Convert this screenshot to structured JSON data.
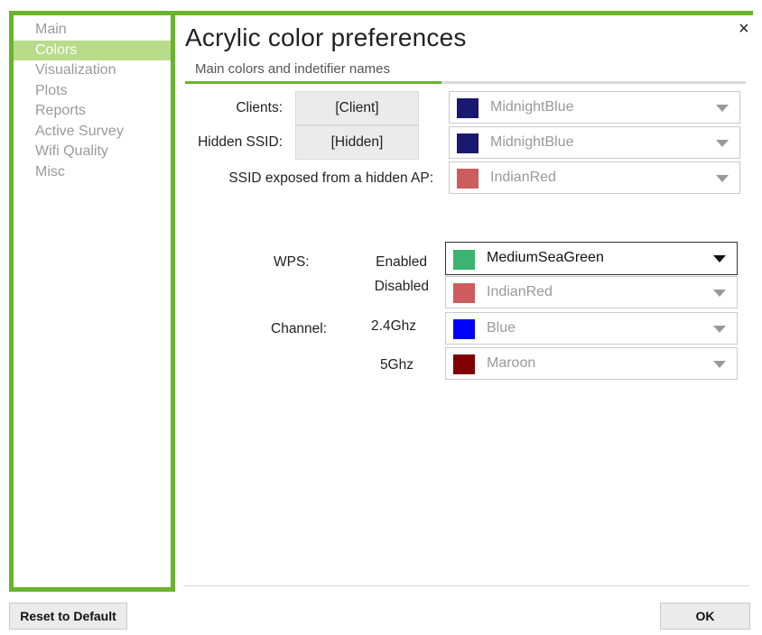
{
  "window": {
    "title": "Acrylic color preferences",
    "subtitle": "Main colors and indetifier names",
    "close_glyph": "×"
  },
  "sidebar": {
    "items": [
      {
        "label": "Main",
        "active": false
      },
      {
        "label": "Colors",
        "active": true
      },
      {
        "label": "Visualization",
        "active": false
      },
      {
        "label": "Plots",
        "active": false
      },
      {
        "label": "Reports",
        "active": false
      },
      {
        "label": "Active Survey",
        "active": false
      },
      {
        "label": "Wifi Quality",
        "active": false
      },
      {
        "label": "Misc",
        "active": false
      }
    ]
  },
  "identifiers": {
    "clients": {
      "label": "Clients:",
      "name": "[Client]",
      "color_name": "MidnightBlue",
      "color": "#191970"
    },
    "hidden_ssid": {
      "label": "Hidden SSID:",
      "name": "[Hidden]",
      "color_name": "MidnightBlue",
      "color": "#191970"
    },
    "ssid_exposed": {
      "label": "SSID exposed from a hidden AP:",
      "color_name": "IndianRed",
      "color": "#CD5C5C"
    }
  },
  "wps": {
    "label": "WPS:",
    "enabled": {
      "label": "Enabled",
      "color_name": "MediumSeaGreen",
      "color": "#3CB371"
    },
    "disabled": {
      "label": "Disabled",
      "color_name": "IndianRed",
      "color": "#CD5C5C"
    }
  },
  "channel": {
    "label": "Channel:",
    "band24": {
      "label": "2.4Ghz",
      "color_name": "Blue",
      "color": "#0000FF"
    },
    "band5": {
      "label": "5Ghz",
      "color_name": "Maroon",
      "color": "#800000"
    }
  },
  "buttons": {
    "reset": "Reset to Default",
    "ok": "OK"
  },
  "accent": "#6ab42d"
}
